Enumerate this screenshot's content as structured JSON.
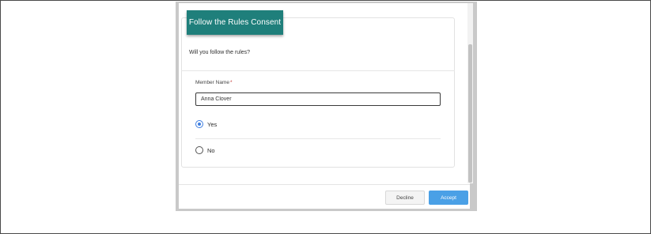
{
  "modal": {
    "title": "Follow the Rules Consent",
    "question": "Will you follow the rules?",
    "member_name": {
      "label": "Member Name",
      "required_marker": "*",
      "value": "Anna Clover"
    },
    "options": [
      {
        "label": "Yes",
        "selected": true
      },
      {
        "label": "No",
        "selected": false
      }
    ],
    "buttons": {
      "decline": "Decline",
      "accept": "Accept"
    }
  },
  "colors": {
    "header_bg": "#1f7f7b",
    "accept_bg": "#4aa0e6",
    "radio_selected": "#3f7ee0",
    "required": "#c23934"
  }
}
